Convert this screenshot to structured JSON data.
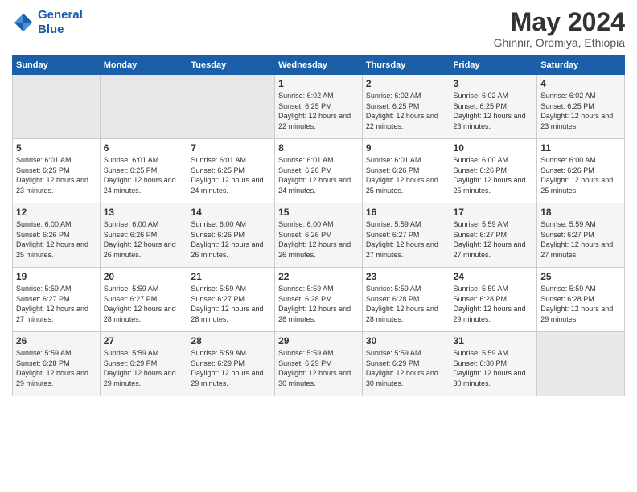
{
  "header": {
    "logo_line1": "General",
    "logo_line2": "Blue",
    "month_year": "May 2024",
    "location": "Ghinnir, Oromiya, Ethiopia"
  },
  "weekdays": [
    "Sunday",
    "Monday",
    "Tuesday",
    "Wednesday",
    "Thursday",
    "Friday",
    "Saturday"
  ],
  "weeks": [
    [
      {
        "day": "",
        "sunrise": "",
        "sunset": "",
        "daylight": ""
      },
      {
        "day": "",
        "sunrise": "",
        "sunset": "",
        "daylight": ""
      },
      {
        "day": "",
        "sunrise": "",
        "sunset": "",
        "daylight": ""
      },
      {
        "day": "1",
        "sunrise": "6:02 AM",
        "sunset": "6:25 PM",
        "daylight": "12 hours and 22 minutes."
      },
      {
        "day": "2",
        "sunrise": "6:02 AM",
        "sunset": "6:25 PM",
        "daylight": "12 hours and 22 minutes."
      },
      {
        "day": "3",
        "sunrise": "6:02 AM",
        "sunset": "6:25 PM",
        "daylight": "12 hours and 23 minutes."
      },
      {
        "day": "4",
        "sunrise": "6:02 AM",
        "sunset": "6:25 PM",
        "daylight": "12 hours and 23 minutes."
      }
    ],
    [
      {
        "day": "5",
        "sunrise": "6:01 AM",
        "sunset": "6:25 PM",
        "daylight": "12 hours and 23 minutes."
      },
      {
        "day": "6",
        "sunrise": "6:01 AM",
        "sunset": "6:25 PM",
        "daylight": "12 hours and 24 minutes."
      },
      {
        "day": "7",
        "sunrise": "6:01 AM",
        "sunset": "6:25 PM",
        "daylight": "12 hours and 24 minutes."
      },
      {
        "day": "8",
        "sunrise": "6:01 AM",
        "sunset": "6:26 PM",
        "daylight": "12 hours and 24 minutes."
      },
      {
        "day": "9",
        "sunrise": "6:01 AM",
        "sunset": "6:26 PM",
        "daylight": "12 hours and 25 minutes."
      },
      {
        "day": "10",
        "sunrise": "6:00 AM",
        "sunset": "6:26 PM",
        "daylight": "12 hours and 25 minutes."
      },
      {
        "day": "11",
        "sunrise": "6:00 AM",
        "sunset": "6:26 PM",
        "daylight": "12 hours and 25 minutes."
      }
    ],
    [
      {
        "day": "12",
        "sunrise": "6:00 AM",
        "sunset": "6:26 PM",
        "daylight": "12 hours and 25 minutes."
      },
      {
        "day": "13",
        "sunrise": "6:00 AM",
        "sunset": "6:26 PM",
        "daylight": "12 hours and 26 minutes."
      },
      {
        "day": "14",
        "sunrise": "6:00 AM",
        "sunset": "6:26 PM",
        "daylight": "12 hours and 26 minutes."
      },
      {
        "day": "15",
        "sunrise": "6:00 AM",
        "sunset": "6:26 PM",
        "daylight": "12 hours and 26 minutes."
      },
      {
        "day": "16",
        "sunrise": "5:59 AM",
        "sunset": "6:27 PM",
        "daylight": "12 hours and 27 minutes."
      },
      {
        "day": "17",
        "sunrise": "5:59 AM",
        "sunset": "6:27 PM",
        "daylight": "12 hours and 27 minutes."
      },
      {
        "day": "18",
        "sunrise": "5:59 AM",
        "sunset": "6:27 PM",
        "daylight": "12 hours and 27 minutes."
      }
    ],
    [
      {
        "day": "19",
        "sunrise": "5:59 AM",
        "sunset": "6:27 PM",
        "daylight": "12 hours and 27 minutes."
      },
      {
        "day": "20",
        "sunrise": "5:59 AM",
        "sunset": "6:27 PM",
        "daylight": "12 hours and 28 minutes."
      },
      {
        "day": "21",
        "sunrise": "5:59 AM",
        "sunset": "6:27 PM",
        "daylight": "12 hours and 28 minutes."
      },
      {
        "day": "22",
        "sunrise": "5:59 AM",
        "sunset": "6:28 PM",
        "daylight": "12 hours and 28 minutes."
      },
      {
        "day": "23",
        "sunrise": "5:59 AM",
        "sunset": "6:28 PM",
        "daylight": "12 hours and 28 minutes."
      },
      {
        "day": "24",
        "sunrise": "5:59 AM",
        "sunset": "6:28 PM",
        "daylight": "12 hours and 29 minutes."
      },
      {
        "day": "25",
        "sunrise": "5:59 AM",
        "sunset": "6:28 PM",
        "daylight": "12 hours and 29 minutes."
      }
    ],
    [
      {
        "day": "26",
        "sunrise": "5:59 AM",
        "sunset": "6:28 PM",
        "daylight": "12 hours and 29 minutes."
      },
      {
        "day": "27",
        "sunrise": "5:59 AM",
        "sunset": "6:29 PM",
        "daylight": "12 hours and 29 minutes."
      },
      {
        "day": "28",
        "sunrise": "5:59 AM",
        "sunset": "6:29 PM",
        "daylight": "12 hours and 29 minutes."
      },
      {
        "day": "29",
        "sunrise": "5:59 AM",
        "sunset": "6:29 PM",
        "daylight": "12 hours and 30 minutes."
      },
      {
        "day": "30",
        "sunrise": "5:59 AM",
        "sunset": "6:29 PM",
        "daylight": "12 hours and 30 minutes."
      },
      {
        "day": "31",
        "sunrise": "5:59 AM",
        "sunset": "6:30 PM",
        "daylight": "12 hours and 30 minutes."
      },
      {
        "day": "",
        "sunrise": "",
        "sunset": "",
        "daylight": ""
      }
    ]
  ]
}
